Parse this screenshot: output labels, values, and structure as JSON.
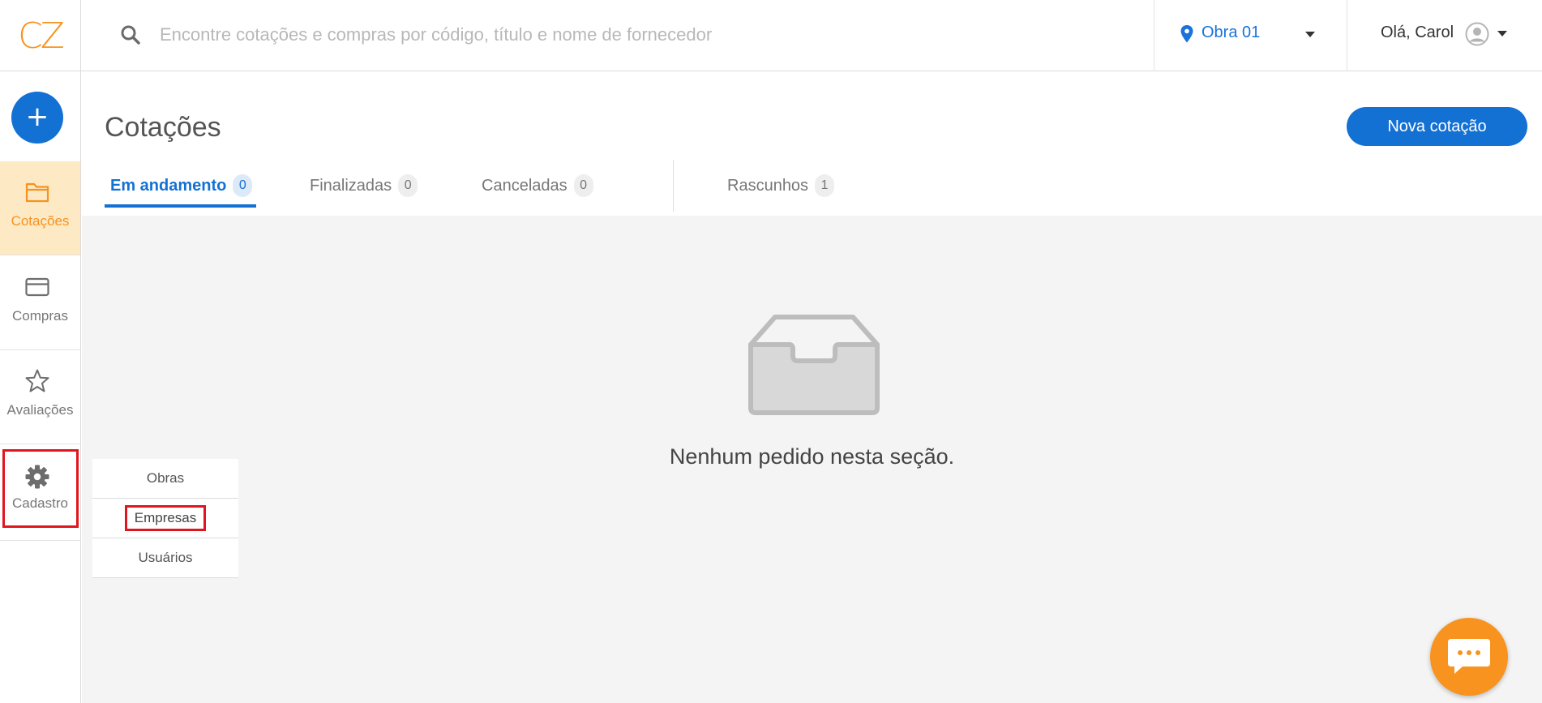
{
  "logo": {
    "text": "CZ"
  },
  "search": {
    "placeholder": "Encontre cotações e compras por código, título e nome de fornecedor"
  },
  "location_selector": {
    "value": "Obra 01"
  },
  "user_menu": {
    "greeting": "Olá, Carol"
  },
  "sidebar": {
    "add_button_label": "+",
    "items": [
      {
        "label": "Cotações",
        "icon": "folder-icon",
        "active": true
      },
      {
        "label": "Compras",
        "icon": "credit-card-icon",
        "active": false
      },
      {
        "label": "Avaliações",
        "icon": "star-icon",
        "active": false
      },
      {
        "label": "Cadastro",
        "icon": "gear-icon",
        "active": false,
        "highlighted": true
      }
    ]
  },
  "page": {
    "title": "Cotações",
    "primary_action_label": "Nova cotação"
  },
  "tabs": [
    {
      "label": "Em andamento",
      "count": "0",
      "active": true
    },
    {
      "label": "Finalizadas",
      "count": "0",
      "active": false
    },
    {
      "label": "Canceladas",
      "count": "0",
      "active": false
    },
    {
      "label": "Rascunhos",
      "count": "1",
      "active": false
    }
  ],
  "empty_state": {
    "icon": "inbox-icon",
    "message": "Nenhum pedido nesta seção."
  },
  "cadastro_submenu": {
    "items": [
      {
        "label": "Obras",
        "highlighted": false
      },
      {
        "label": "Empresas",
        "highlighted": true
      },
      {
        "label": "Usuários",
        "highlighted": false
      }
    ]
  },
  "chat_widget": {
    "icon": "chat-bubble-icon"
  },
  "colors": {
    "brand_orange": "#f7931e",
    "primary_blue": "#1471d4",
    "active_nav_bg": "#fde9c4",
    "highlight_red": "#e0161f",
    "content_bg": "#f4f4f4"
  }
}
